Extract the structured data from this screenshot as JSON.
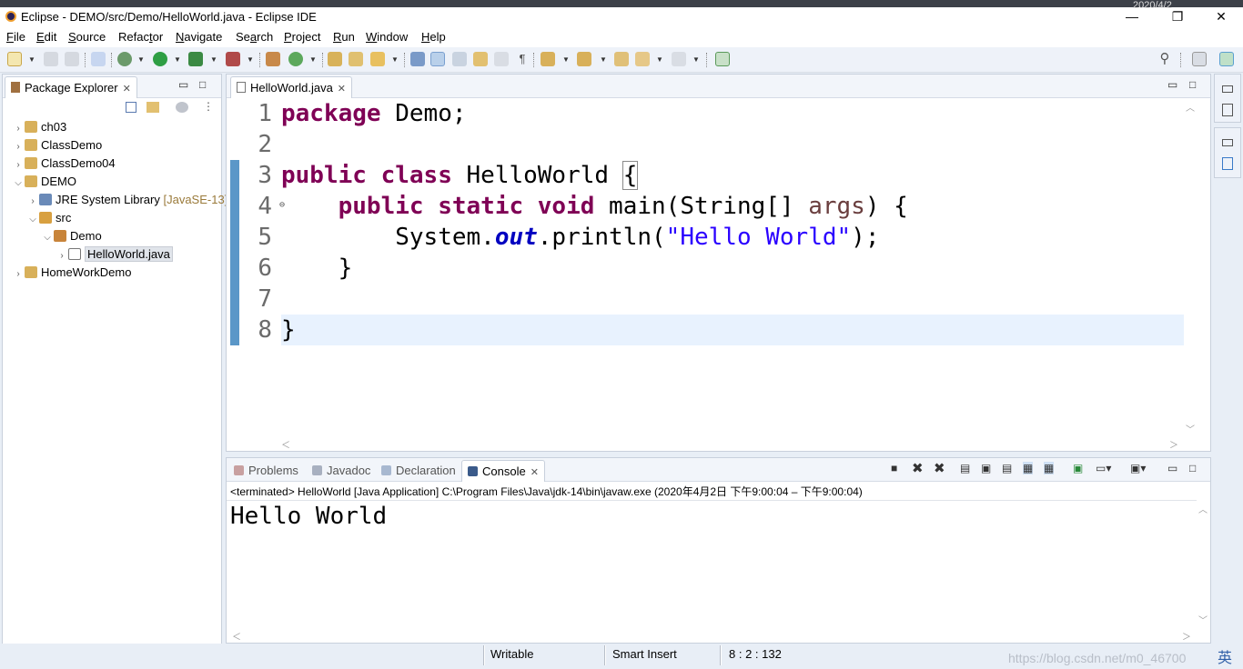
{
  "window": {
    "title": "Eclipse - DEMO/src/Demo/HelloWorld.java - Eclipse IDE",
    "clock_partial": "2020/4/2",
    "controls": {
      "minimize": "—",
      "restore": "❐",
      "close": "✕"
    }
  },
  "menu": [
    {
      "label": "File",
      "mnemonic": "F"
    },
    {
      "label": "Edit",
      "mnemonic": "E"
    },
    {
      "label": "Source",
      "mnemonic": "S"
    },
    {
      "label": "Refactor",
      "mnemonic": "t"
    },
    {
      "label": "Navigate",
      "mnemonic": "N"
    },
    {
      "label": "Search",
      "mnemonic": "a"
    },
    {
      "label": "Project",
      "mnemonic": "P"
    },
    {
      "label": "Run",
      "mnemonic": "R"
    },
    {
      "label": "Window",
      "mnemonic": "W"
    },
    {
      "label": "Help",
      "mnemonic": "H"
    }
  ],
  "package_explorer": {
    "tab_label": "Package Explorer",
    "close": "✕",
    "tree": [
      {
        "name": "ch03",
        "icon": "project-icon",
        "expanded": false
      },
      {
        "name": "ClassDemo",
        "icon": "project-icon",
        "expanded": false
      },
      {
        "name": "ClassDemo04",
        "icon": "project-icon",
        "expanded": false
      },
      {
        "name": "DEMO",
        "icon": "project-icon",
        "expanded": true
      },
      {
        "name": "JRE System Library",
        "decoration": "[JavaSE-13]",
        "icon": "library-icon",
        "expanded": false
      },
      {
        "name": "src",
        "icon": "source-folder-icon",
        "expanded": true
      },
      {
        "name": "Demo",
        "icon": "package-icon",
        "expanded": true
      },
      {
        "name": "HelloWorld.java",
        "icon": "java-file-icon",
        "expanded": false,
        "selected": true
      },
      {
        "name": "HomeWorkDemo",
        "icon": "project-icon",
        "expanded": false
      }
    ]
  },
  "editor": {
    "tab_label": "HelloWorld.java",
    "close": "✕",
    "line_numbers": [
      "1",
      "2",
      "3",
      "4",
      "5",
      "6",
      "7",
      "8"
    ],
    "fold_marker": "⊖",
    "code": {
      "l1_kw": "package",
      "l1_rest": " Demo;",
      "l3_kw1": "public",
      "l3_kw2": "class",
      "l3_name": " HelloWorld ",
      "l3_brace": "{",
      "l4_indent": "    ",
      "l4_kw1": "public",
      "l4_kw2": "static",
      "l4_kw3": "void",
      "l4_rest1": " main(String[] ",
      "l4_param": "args",
      "l4_rest2": ") {",
      "l5_indent": "        ",
      "l5_a": "System.",
      "l5_field": "out",
      "l5_b": ".println(",
      "l5_str": "\"Hello World\"",
      "l5_c": ");",
      "l6": "    }",
      "l8": "}"
    }
  },
  "bottom_panel": {
    "tabs": [
      {
        "label": "Problems",
        "icon": "problems-icon",
        "active": false
      },
      {
        "label": "Javadoc",
        "icon": "javadoc-icon",
        "active": false
      },
      {
        "label": "Declaration",
        "icon": "declaration-icon",
        "active": false
      },
      {
        "label": "Console",
        "icon": "console-icon",
        "active": true
      }
    ],
    "close": "✕",
    "console_header": "<terminated> HelloWorld [Java Application] C:\\Program Files\\Java\\jdk-14\\bin\\javaw.exe  (2020年4月2日 下午9:00:04 – 下午9:00:04)",
    "console_output": "Hello World"
  },
  "status": {
    "writable": "Writable",
    "insert_mode": "Smart Insert",
    "position": "8 : 2 : 132",
    "watermark": "https://blog.csdn.net/m0_46700",
    "ime": "英"
  },
  "colors": {
    "keyword": "#7f0055",
    "string": "#2a00ff",
    "field": "#0000c0",
    "ruler": "#5b97c8",
    "current_line": "#e8f2fe"
  }
}
